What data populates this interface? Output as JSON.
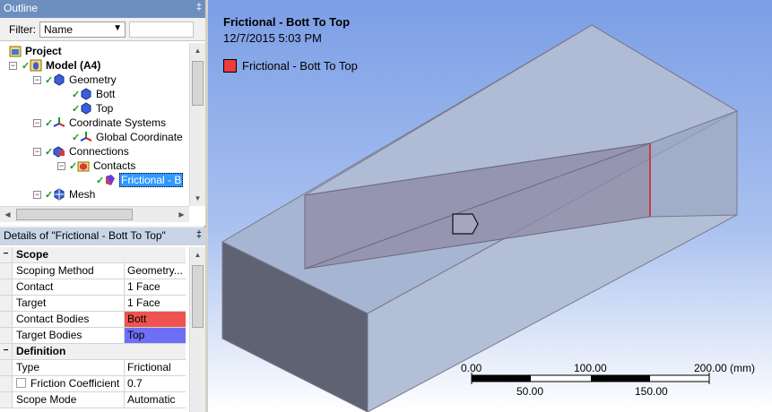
{
  "outline": {
    "title": "Outline",
    "pin": "‡",
    "filter_label": "Filter:",
    "filter_value": "Name",
    "tree": [
      {
        "label": "Project",
        "bold": true
      },
      {
        "label": "Model (A4)",
        "bold": true
      },
      {
        "label": "Geometry"
      },
      {
        "label": "Bott"
      },
      {
        "label": "Top"
      },
      {
        "label": "Coordinate Systems"
      },
      {
        "label": "Global Coordinate"
      },
      {
        "label": "Connections"
      },
      {
        "label": "Contacts"
      },
      {
        "label": "Frictional - B",
        "selected": true
      },
      {
        "label": "Mesh"
      }
    ]
  },
  "details": {
    "title": "Details of \"Frictional - Bott To Top\"",
    "pin": "‡",
    "scope_group": "Scope",
    "scoping_method_label": "Scoping Method",
    "scoping_method_value": "Geometry...",
    "contact_label": "Contact",
    "contact_value": "1 Face",
    "target_label": "Target",
    "target_value": "1 Face",
    "contact_bodies_label": "Contact Bodies",
    "contact_bodies_value": "Bott",
    "target_bodies_label": "Target Bodies",
    "target_bodies_value": "Top",
    "definition_group": "Definition",
    "type_label": "Type",
    "type_value": "Frictional",
    "friction_label": "Friction Coefficient",
    "friction_value": "0.7",
    "scope_mode_label": "Scope Mode",
    "scope_mode_value": "Automatic"
  },
  "viewport": {
    "title": "Frictional - Bott To Top",
    "date": "12/7/2015 5:03 PM",
    "legend_label": "Frictional - Bott To Top",
    "legend_color": "#ef3b3b",
    "scale_top": [
      "0.00",
      "100.00",
      "200.00 (mm)"
    ],
    "scale_bottom": [
      "50.00",
      "150.00"
    ]
  },
  "colors": {
    "contact_bodies": "#ef5350",
    "target_bodies": "#6f6ff5",
    "selection": "#3399ff"
  }
}
